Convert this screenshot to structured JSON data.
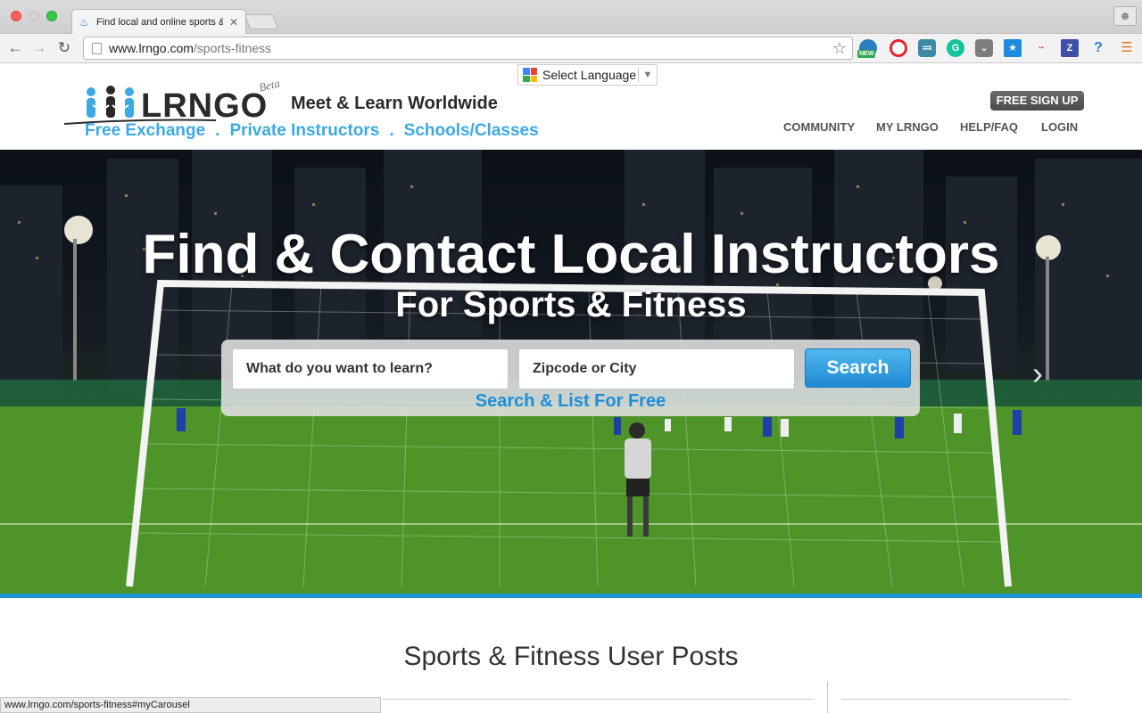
{
  "browser": {
    "tab_title": "Find local and online sports & fitness",
    "url_host": "www.lrngo.com",
    "url_path": "/sports-fitness",
    "status_url": "www.lrngo.com/sports-fitness#myCarousel",
    "extensions": [
      "new-badge-extension",
      "opera-extension",
      "c-extension",
      "grammarly-extension",
      "pocket-extension",
      "bookmark-extension",
      "signal-extension",
      "z-extension",
      "help-extension",
      "menu-icon"
    ],
    "new_badge": "NEW",
    "ext_z": "Z",
    "ext_help": "?"
  },
  "header": {
    "language": "Select Language",
    "logo": "LRNGO",
    "beta": "Beta",
    "tagline": "Meet & Learn Worldwide",
    "subnav": [
      "Free Exchange",
      "Private Instructors",
      "Schools/Classes"
    ],
    "subnav_sep": ".",
    "signup": "FREE SIGN UP",
    "nav": [
      "COMMUNITY",
      "MY LRNGO",
      "HELP/FAQ",
      "LOGIN"
    ]
  },
  "hero": {
    "title": "Find & Contact Local Instructors",
    "subtitle": "For Sports & Fitness",
    "learn_placeholder": "What do you want to learn?",
    "zip_placeholder": "Zipcode or City",
    "search_button": "Search",
    "list_link": "Search & List For Free"
  },
  "section": {
    "title": "Sports & Fitness User Posts"
  }
}
